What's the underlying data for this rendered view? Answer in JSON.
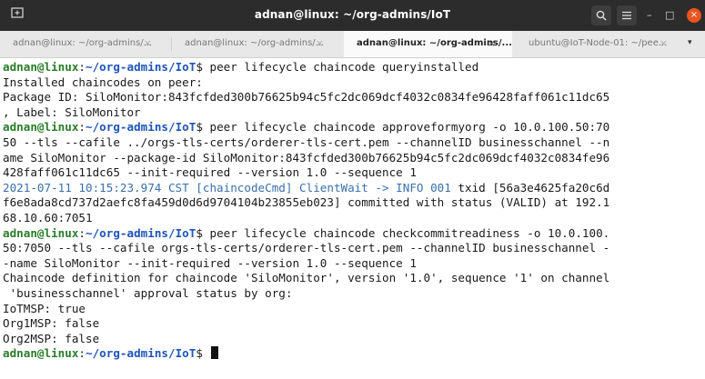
{
  "window": {
    "title": "adnan@linux: ~/org-admins/IoT",
    "new_tab_icon": "new-tab-icon",
    "search_icon": "search-icon",
    "menu_icon": "hamburger-menu-icon",
    "minimize_label": "–",
    "maximize_label": "□",
    "close_label": "×"
  },
  "tabs": [
    {
      "label": "adnan@linux: ~/org-admins/...",
      "active": false
    },
    {
      "label": "adnan@linux: ~/org-admins/...",
      "active": false
    },
    {
      "label": "adnan@linux: ~/org-admins/...",
      "active": true
    },
    {
      "label": "ubuntu@IoT-Node-01: ~/pee...",
      "active": false
    }
  ],
  "tab_close_label": "×",
  "tab_menu_label": "▾",
  "prompt": {
    "userhost": "adnan@linux",
    "colon": ":",
    "path": "~/org-admins/IoT",
    "dollar": "$ "
  },
  "terminal": {
    "cmd1": "peer lifecycle chaincode queryinstalled",
    "out1": [
      "Installed chaincodes on peer:",
      "Package ID: SiloMonitor:843fcfded300b76625b94c5fc2dc069dcf4032c0834fe96428faff061c11dc65",
      ", Label: SiloMonitor"
    ],
    "cmd2_lines": [
      "peer lifecycle chaincode approveformyorg -o 10.0.100.50:70",
      "50 --tls --cafile ../orgs-tls-certs/orderer-tls-cert.pem --channelID businesschannel --n",
      "ame SiloMonitor --package-id SiloMonitor:843fcfded300b76625b94c5fc2dc069dcf4032c0834fe96",
      "428faff061c11dc65 --init-required --version 1.0 --sequence 1"
    ],
    "log_head": "2021-07-11 10:15:23.974 CST [chaincodeCmd] ClientWait -> INFO 001",
    "log_tail": " txid [56a3e4625fa20c6d",
    "out2": [
      "f6e8ada8cd737d2aefc8fa459d0d6d9704104b23855eb023] committed with status (VALID) at 192.1",
      "68.10.60:7051"
    ],
    "cmd3_lines": [
      "peer lifecycle chaincode checkcommitreadiness -o 10.0.100.",
      "50:7050 --tls --cafile orgs-tls-certs/orderer-tls-cert.pem --channelID businesschannel -",
      "-name SiloMonitor --init-required --version 1.0 --sequence 1"
    ],
    "out3": [
      "Chaincode definition for chaincode 'SiloMonitor', version '1.0', sequence '1' on channel",
      " 'businesschannel' approval status by org:",
      "IoTMSP: true",
      "Org1MSP: false",
      "Org2MSP: false"
    ]
  },
  "colors": {
    "prompt_userhost": "#2a7d2a",
    "prompt_path": "#1f54b8",
    "log_text": "#3a6fa8",
    "titlebar": "#2c2c2c",
    "close_button": "#e95420"
  }
}
